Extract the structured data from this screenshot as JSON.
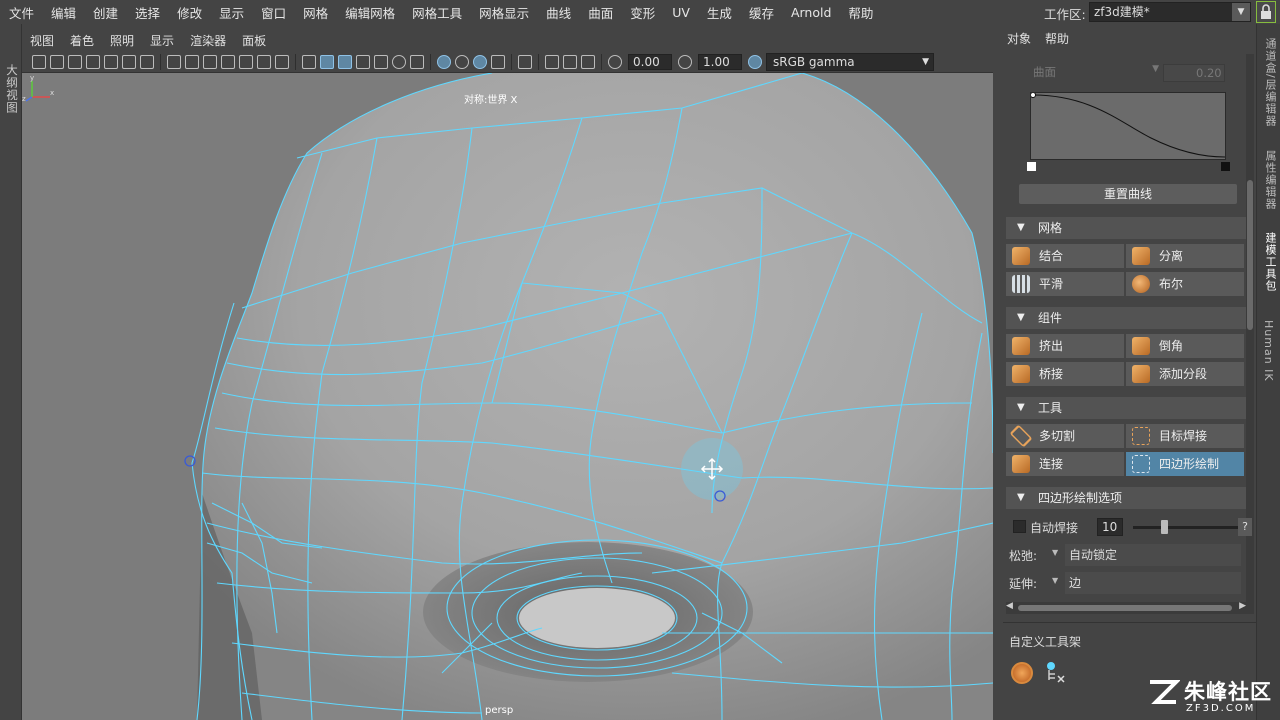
{
  "menubar": {
    "items": [
      "文件",
      "编辑",
      "创建",
      "选择",
      "修改",
      "显示",
      "窗口",
      "网格",
      "编辑网格",
      "网格工具",
      "网格显示",
      "曲线",
      "曲面",
      "变形",
      "UV",
      "生成",
      "缓存",
      "Arnold",
      "帮助"
    ],
    "workspace_label": "工作区:",
    "workspace_value": "zf3d建模*"
  },
  "left_strip": {
    "outliner_tab": "大纲视图"
  },
  "viewport": {
    "panel_menu": [
      "视图",
      "着色",
      "照明",
      "显示",
      "渲染器",
      "面板"
    ],
    "exposure_value": "0.00",
    "gamma_value": "1.00",
    "color_space": "sRGB gamma",
    "symmetry_label": "对称:世界 X",
    "camera_label": "persp",
    "gizmo": {
      "x": "x",
      "y": "y",
      "z": "z"
    }
  },
  "right_panel": {
    "menu": [
      "对象",
      "帮助"
    ],
    "curve_type": "曲面",
    "curve_value": "0.20",
    "reset_curve_label": "重置曲线",
    "sections": {
      "mesh": {
        "title": "网格",
        "buttons": [
          {
            "label": "结合",
            "icon": "combine-icon"
          },
          {
            "label": "分离",
            "icon": "separate-icon"
          },
          {
            "label": "平滑",
            "icon": "smooth-icon"
          },
          {
            "label": "布尔",
            "icon": "boolean-icon"
          }
        ]
      },
      "components": {
        "title": "组件",
        "buttons": [
          {
            "label": "挤出",
            "icon": "extrude-icon"
          },
          {
            "label": "倒角",
            "icon": "bevel-icon"
          },
          {
            "label": "桥接",
            "icon": "bridge-icon"
          },
          {
            "label": "添加分段",
            "icon": "add-divisions-icon"
          }
        ]
      },
      "tools": {
        "title": "工具",
        "buttons": [
          {
            "label": "多切割",
            "icon": "multi-cut-icon"
          },
          {
            "label": "目标焊接",
            "icon": "target-weld-icon"
          },
          {
            "label": "连接",
            "icon": "connect-icon"
          },
          {
            "label": "四边形绘制",
            "icon": "quad-draw-icon"
          }
        ]
      },
      "quad_draw_options": {
        "title": "四边形绘制选项",
        "autoweld_label": "自动焊接",
        "autoweld_value": "10",
        "help": "?",
        "relax_label": "松弛:",
        "relax_value": "自动锁定",
        "extend_label": "延伸:",
        "extend_value": "边"
      }
    },
    "custom_shelf_title": "自定义工具架"
  },
  "right_tabs": [
    "通道盒/层编辑器",
    "属性编辑器",
    "建模工具包",
    "Human IK"
  ],
  "watermark": {
    "name": "朱峰社区",
    "url": "ZF3D.COM"
  },
  "colors": {
    "wireframe": "#5fd8ff",
    "active_button": "#5285a6",
    "viewport_bg": "#7c7c7c",
    "lock_border": "#86bd3e"
  }
}
